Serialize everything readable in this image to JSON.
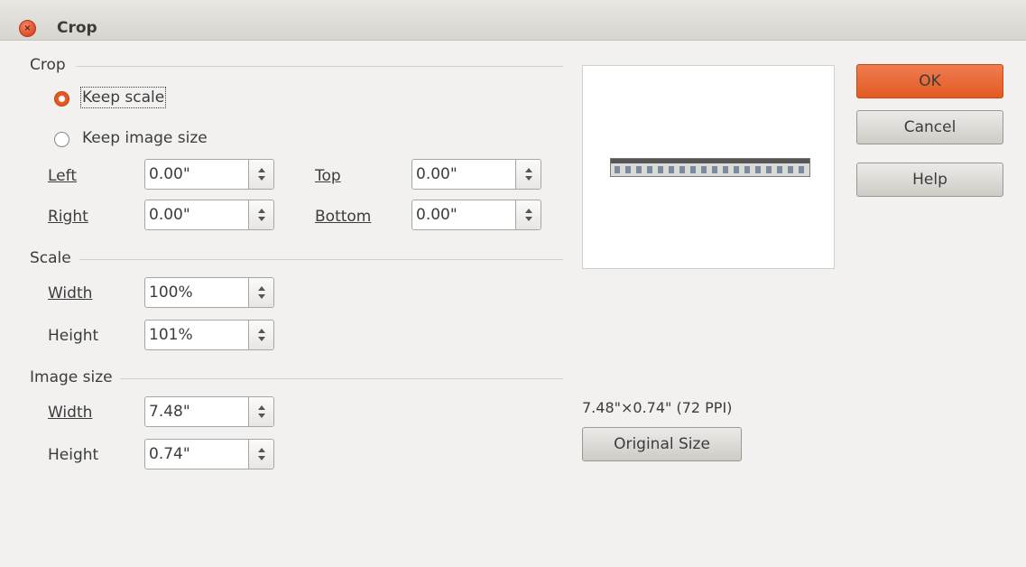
{
  "window": {
    "title": "Crop"
  },
  "crop": {
    "section": "Crop",
    "keep_scale": "Keep scale",
    "keep_image_size": "Keep image size",
    "left_label": "Left",
    "left_value": "0.00\"",
    "right_label": "Right",
    "right_value": "0.00\"",
    "top_label": "Top",
    "top_value": "0.00\"",
    "bottom_label": "Bottom",
    "bottom_value": "0.00\""
  },
  "scale": {
    "section": "Scale",
    "width_label": "Width",
    "width_value": "100%",
    "height_label": "Height",
    "height_value": "101%"
  },
  "image_size": {
    "section": "Image size",
    "width_label": "Width",
    "width_value": "7.48\"",
    "height_label": "Height",
    "height_value": "0.74\""
  },
  "info": {
    "dimensions": "7.48\"×0.74\" (72 PPI)"
  },
  "buttons": {
    "ok": "OK",
    "cancel": "Cancel",
    "help": "Help",
    "original_size": "Original Size"
  },
  "colors": {
    "accent": "#e35a22",
    "close": "#df4b25"
  }
}
